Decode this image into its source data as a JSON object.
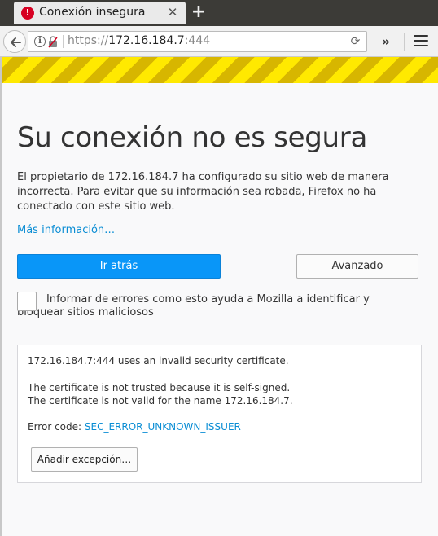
{
  "browser": {
    "tab_title": "Conexión insegura",
    "tab_error_glyph": "!",
    "tab_close_glyph": "✕",
    "new_tab_glyph": "+",
    "url_scheme": "https://",
    "url_host": "172.16.184.7",
    "url_port": ":444",
    "reload_glyph": "⟳",
    "overflow_glyph": "»",
    "info_glyph": "i"
  },
  "page": {
    "title": "Su conexión no es segura",
    "description": "El propietario de 172.16.184.7 ha configurado su sitio web de manera incorrecta. Para evitar que su información sea robada, Firefox no ha conectado con este sitio web.",
    "more_info_link": "Más información…",
    "go_back_button": "Ir atrás",
    "advanced_button": "Avanzado",
    "report_checkbox_label": "Informar de errores como esto ayuda a Mozilla a identificar y bloquear sitios maliciosos",
    "report_checked": false
  },
  "details": {
    "line1": "172.16.184.7:444 uses an invalid security certificate.",
    "line2": "The certificate is not trusted because it is self-signed.",
    "line3": "The certificate is not valid for the name 172.16.184.7.",
    "error_code_label": "Error code: ",
    "error_code": "SEC_ERROR_UNKNOWN_ISSUER",
    "add_exception_button": "Añadir excepción…"
  },
  "colors": {
    "primary_button": "#0996f8",
    "link": "#0a8dd4",
    "stripe_yellow": "#ffe900",
    "stripe_dark": "#d7b600",
    "error_red": "#d70022",
    "tabstrip": "#3c3b37"
  },
  "icons": [
    "error-icon",
    "close-icon",
    "plus-icon",
    "back-arrow-icon",
    "info-icon",
    "lock-icon",
    "reload-icon",
    "overflow-icon",
    "hamburger-menu-icon"
  ]
}
